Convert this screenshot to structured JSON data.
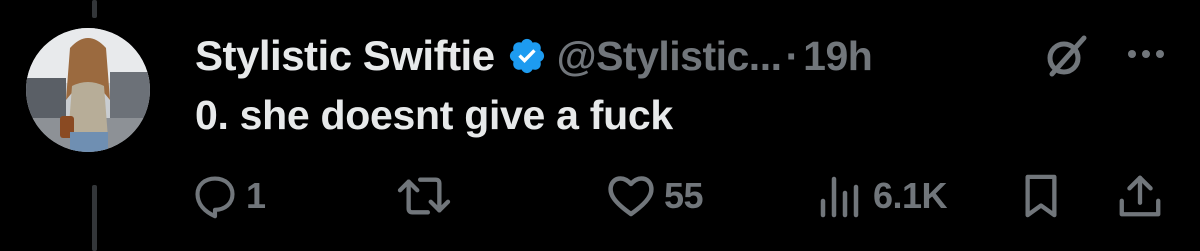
{
  "tweet": {
    "display_name": "Stylistic Swiftie",
    "handle": "@Stylistic...",
    "separator": "·",
    "time": "19h",
    "text": "0. she doesnt give a fuck",
    "verified": true
  },
  "actions": {
    "reply_count": "1",
    "like_count": "55",
    "views_count": "6.1K"
  },
  "icons": {
    "reply": "reply-icon",
    "retweet": "retweet-icon",
    "like": "heart-icon",
    "views": "views-icon",
    "bookmark": "bookmark-icon",
    "share": "share-icon",
    "grok": "grok-icon",
    "more": "more-icon",
    "verified": "verified-badge-icon"
  },
  "colors": {
    "background": "#000000",
    "text_primary": "#e7e9ea",
    "text_secondary": "#71767b",
    "verified_blue": "#1d9bf0"
  }
}
